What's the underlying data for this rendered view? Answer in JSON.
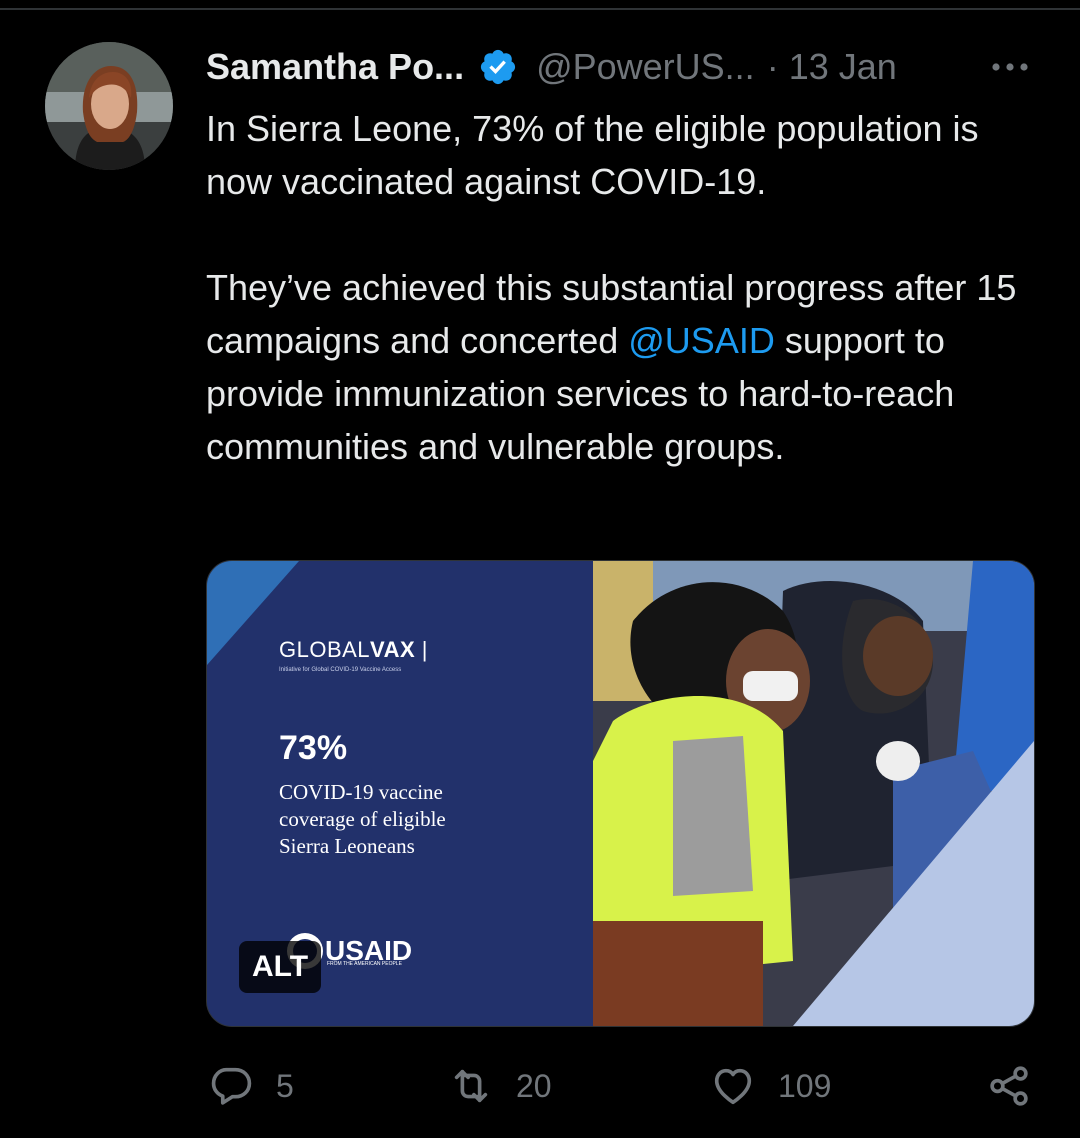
{
  "tweet": {
    "author_name": "Samantha Po...",
    "handle": "@PowerUS...",
    "separator": "·",
    "date": "13 Jan",
    "paragraph1": "In Sierra Leone, 73% of the eligible population is now vaccinated against COVID-19.",
    "paragraph2_before": "They’ve achieved this substantial progress after 15 campaigns and concerted ",
    "mention": "@USAID",
    "paragraph2_after": " support to provide immunization services to hard-to-reach communities and vulnerable groups."
  },
  "media": {
    "logo_light": "GLOBAL",
    "logo_bold": "VAX",
    "logo_sub": "Initiative for Global COVID-19 Vaccine Access",
    "stat": "73%",
    "stat_line1": "COVID-19 vaccine",
    "stat_line2": "coverage of eligible",
    "stat_line3": "Sierra Leoneans",
    "usaid": "USAID",
    "usaid_sub": "FROM THE AMERICAN PEOPLE",
    "alt_label": "ALT"
  },
  "actions": {
    "replies": "5",
    "retweets": "20",
    "likes": "109"
  },
  "colors": {
    "background": "#000000",
    "text": "#e7e9ea",
    "muted": "#71767b",
    "accent": "#1d9bf0",
    "media_navy": "#22316b"
  }
}
